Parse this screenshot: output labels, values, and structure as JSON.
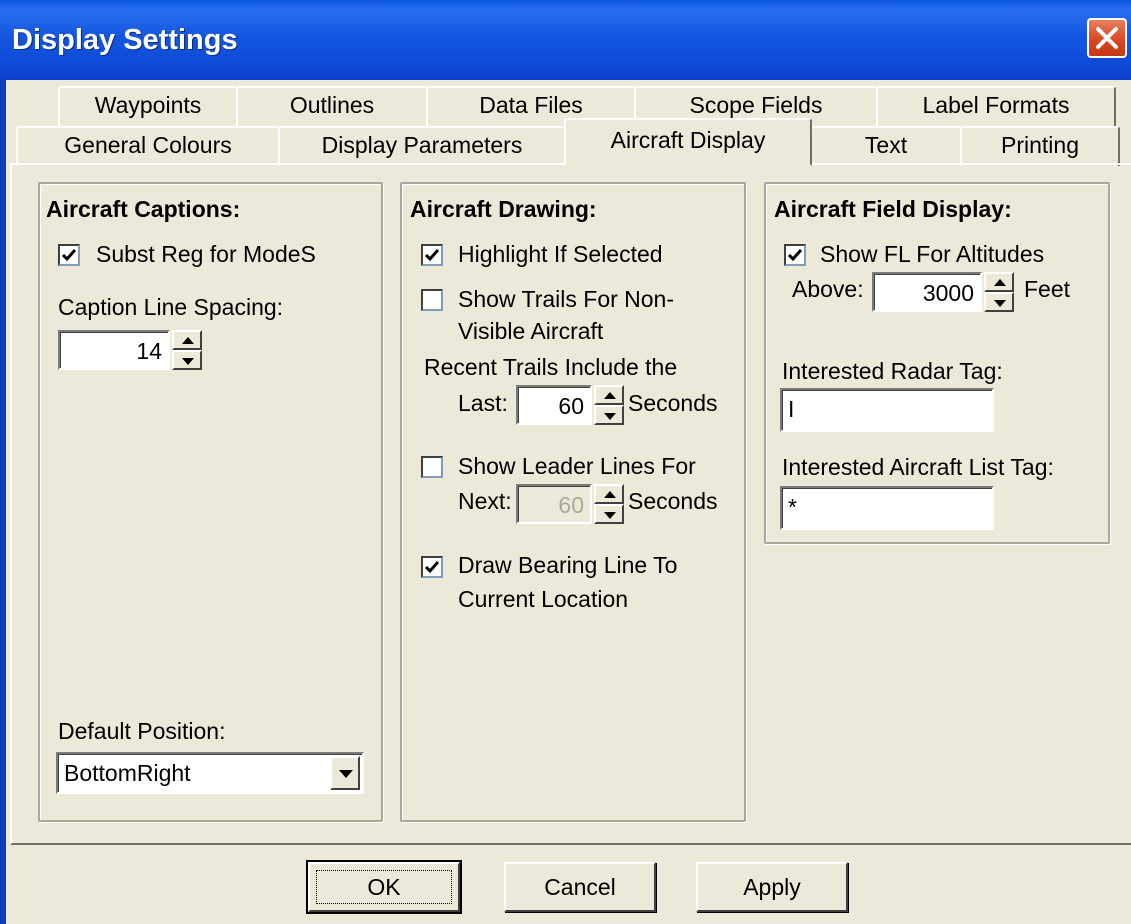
{
  "window": {
    "title": "Display Settings"
  },
  "tabs": {
    "row1": [
      "Waypoints",
      "Outlines",
      "Data Files",
      "Scope Fields",
      "Label Formats"
    ],
    "row2": [
      "General Colours",
      "Display Parameters",
      "Aircraft Display",
      "Text",
      "Printing"
    ],
    "active": "Aircraft Display"
  },
  "aircraft_captions": {
    "title": "Aircraft Captions:",
    "subst_reg_label": "Subst Reg for ModeS",
    "subst_reg_checked": true,
    "line_spacing_label": "Caption Line Spacing:",
    "line_spacing_value": "14",
    "default_position_label": "Default Position:",
    "default_position_value": "BottomRight"
  },
  "aircraft_drawing": {
    "title": "Aircraft Drawing:",
    "highlight_label": "Highlight If Selected",
    "highlight_checked": true,
    "trails_label_1": "Show Trails For Non-",
    "trails_label_2": "Visible Aircraft",
    "trails_checked": false,
    "recent_trails_label": "Recent Trails Include the",
    "last_label": "Last:",
    "last_value": "60",
    "last_unit": "Seconds",
    "leader_label": "Show Leader Lines For",
    "leader_checked": false,
    "next_label": "Next:",
    "next_value": "60",
    "next_unit": "Seconds",
    "bearing_label_1": "Draw Bearing Line To",
    "bearing_label_2": "Current Location",
    "bearing_checked": true
  },
  "aircraft_field_display": {
    "title": "Aircraft Field Display:",
    "show_fl_label": "Show FL For Altitudes",
    "show_fl_checked": true,
    "above_label": "Above:",
    "above_value": "3000",
    "above_unit": "Feet",
    "radar_tag_label": "Interested Radar Tag:",
    "radar_tag_value": "I",
    "list_tag_label": "Interested Aircraft List Tag:",
    "list_tag_value": "*"
  },
  "buttons": {
    "ok": "OK",
    "cancel": "Cancel",
    "apply": "Apply"
  }
}
